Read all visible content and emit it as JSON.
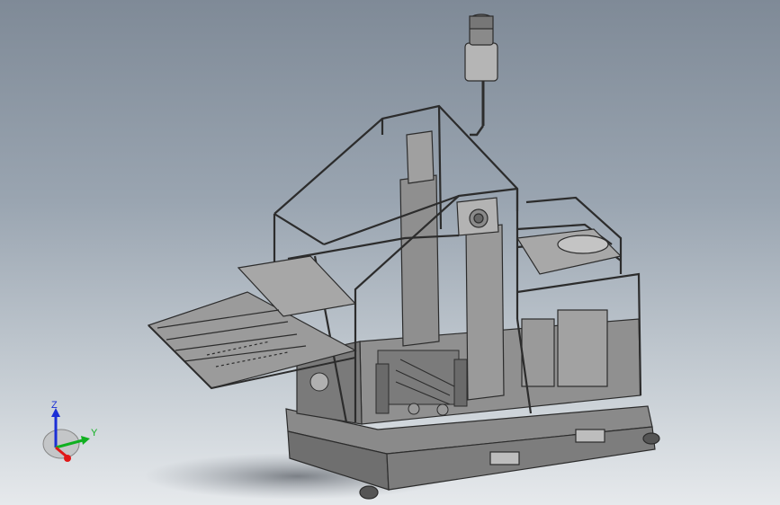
{
  "viewport": {
    "background_top": "#7f8a97",
    "background_bottom": "#e6e9ec",
    "model_color": "#8e8e8e",
    "edge_color": "#2c2c2c"
  },
  "triad": {
    "z_label": "Z",
    "y_label": "Y",
    "z_color": "#1b2fd6",
    "y_color": "#10b020",
    "x_color": "#e01818"
  }
}
